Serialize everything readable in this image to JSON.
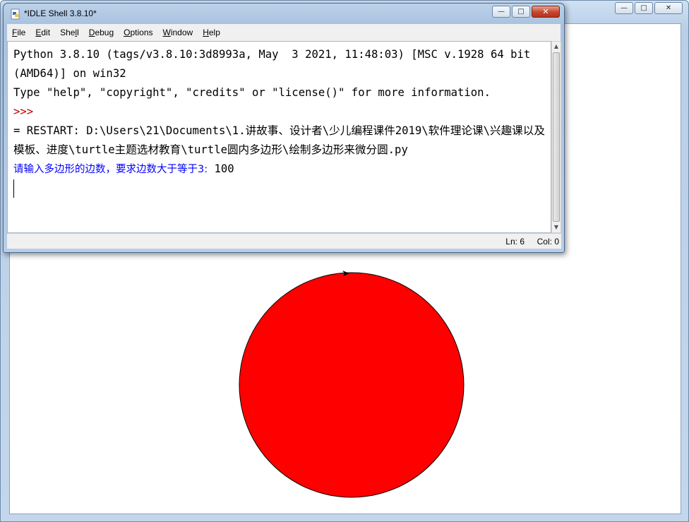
{
  "turtle_window": {
    "buttons": {
      "minimize": "—",
      "maximize": "□",
      "close": "✕"
    },
    "shapes": {
      "polygon_sides": 100,
      "fill_color": "#ff0000",
      "outline_color": "#000000"
    }
  },
  "idle_window": {
    "title": "*IDLE Shell 3.8.10*",
    "buttons": {
      "minimize": "—",
      "maximize": "□",
      "close": "✕"
    },
    "menu": [
      {
        "accel": "F",
        "rest": "ile"
      },
      {
        "accel": "E",
        "rest": "dit"
      },
      {
        "pre": "She",
        "accel": "l",
        "rest": "l"
      },
      {
        "accel": "D",
        "rest": "ebug"
      },
      {
        "accel": "O",
        "rest": "ptions"
      },
      {
        "accel": "W",
        "rest": "indow"
      },
      {
        "accel": "H",
        "rest": "elp"
      }
    ],
    "shell": {
      "banner": "Python 3.8.10 (tags/v3.8.10:3d8993a, May  3 2021, 11:48:03) [MSC v.1928 64 bit (AMD64)] on win32",
      "info": "Type \"help\", \"copyright\", \"credits\" or \"license()\" for more information.",
      "prompt": ">>>",
      "restart": "= RESTART: D:\\Users\\21\\Documents\\1.讲故事、设计者\\少儿编程课件2019\\软件理论课\\兴趣课以及模板、进度\\turtle主题选材教育\\turtle圆内多边形\\绘制多边形来微分圆.py",
      "input_prompt": "请输入多边形的边数，要求边数大于等于3:",
      "input_value": " 100"
    },
    "status": {
      "line": "Ln: 6",
      "col": "Col: 0"
    }
  }
}
